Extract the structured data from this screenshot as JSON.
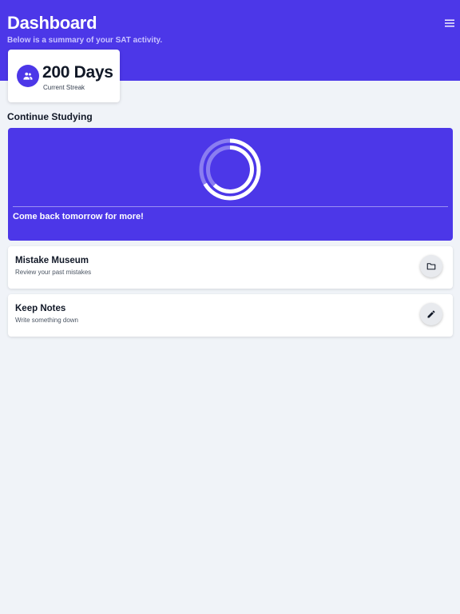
{
  "header": {
    "title": "Dashboard",
    "subtitle": "Below is a summary of your SAT activity.",
    "menu_icon": "hamburger-menu-icon",
    "background": "#4c37e8"
  },
  "streak": {
    "value": "200 Days",
    "label": "Current Streak",
    "icon": "users-icon"
  },
  "continue_studying": {
    "section_title": "Continue Studying",
    "message": "Come back tomorrow for more!",
    "icon": "progress-ring-icon"
  },
  "cards": [
    {
      "title": "Mistake Museum",
      "description": "Review your past mistakes",
      "icon": "folder-icon"
    },
    {
      "title": "Keep Notes",
      "description": "Write something down",
      "icon": "pencil-icon"
    }
  ],
  "colors": {
    "accent": "#4c37e8",
    "page_background": "#f0f3f8",
    "card_background": "#ffffff"
  }
}
